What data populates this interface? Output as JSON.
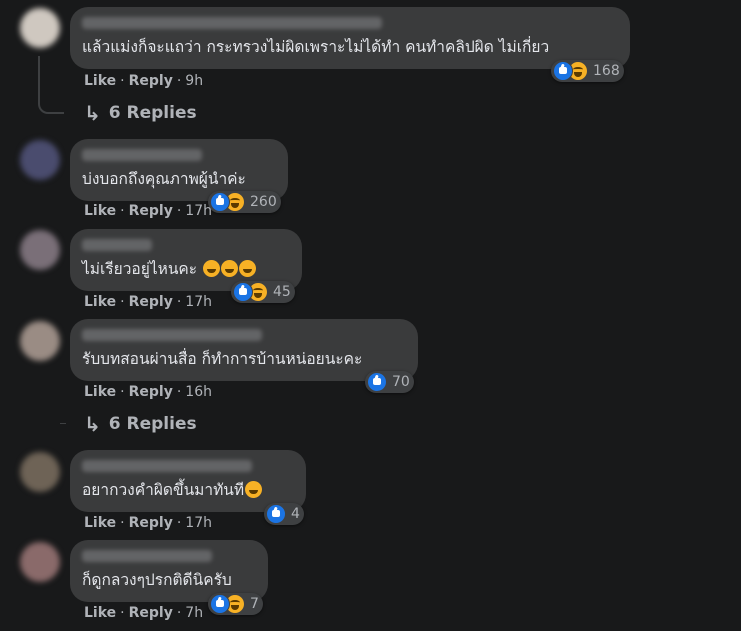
{
  "actions": {
    "like": "Like",
    "reply": "Reply"
  },
  "comments": [
    {
      "text": "แล้วแม่งก็จะแถว่า กระทรวงไม่ผิดเพราะไม่ได้ทำ คนทำคลิปผิด ไม่เกี่ยว",
      "reactions": [
        "like",
        "haha"
      ],
      "count": "168",
      "time": "9h"
    },
    {
      "text": "บ่งบอกถึงคุณภาพผู้นำค่ะ",
      "reactions": [
        "like",
        "haha"
      ],
      "count": "260",
      "time": "17h"
    },
    {
      "text": "ไม่เรียวอยู่ไหนคะ",
      "emoji_suffix": 3,
      "reactions": [
        "like",
        "haha"
      ],
      "count": "45",
      "time": "17h"
    },
    {
      "text": "รับบทสอนผ่านสื่อ ก็ทำการบ้านหน่อยนะคะ",
      "reactions": [
        "like"
      ],
      "count": "70",
      "time": "16h"
    },
    {
      "text": "อยากวงคำผิดขึ้นมาทันที",
      "emoji_suffix": 1,
      "reactions": [
        "like"
      ],
      "count": "4",
      "time": "17h"
    },
    {
      "text": "ก็ดูกลวงๆปรกติดีนิครับ",
      "reactions": [
        "like",
        "haha"
      ],
      "count": "7",
      "time": "7h"
    }
  ],
  "replies_1": "6 Replies",
  "replies_2": "6 Replies"
}
